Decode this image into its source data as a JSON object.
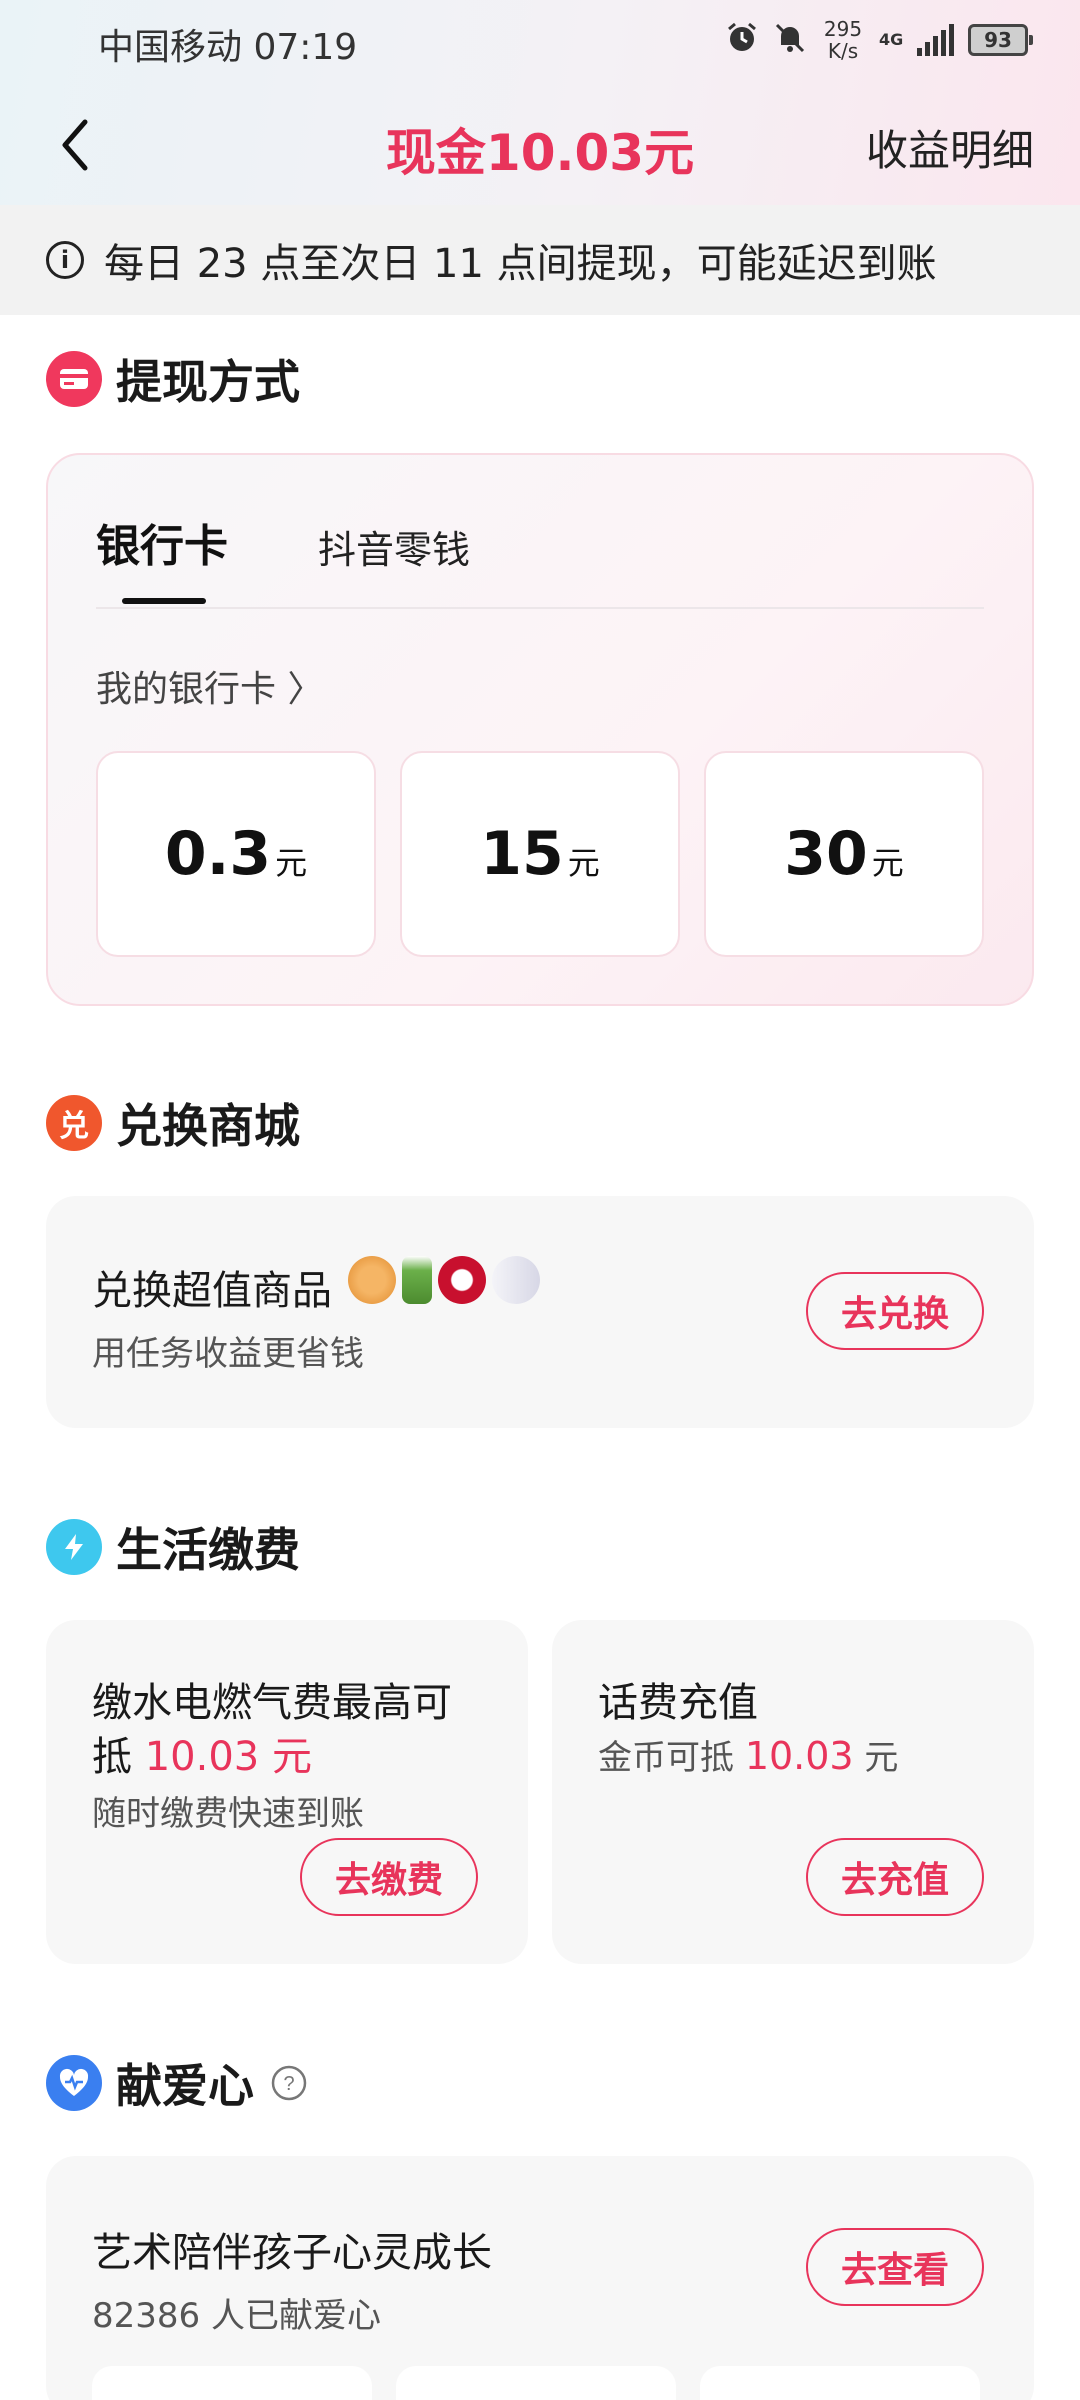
{
  "status_bar": {
    "carrier_time": "中国移动 07:19",
    "net_speed_value": "295",
    "net_speed_unit": "K/s",
    "network": "4G",
    "battery": "93"
  },
  "nav": {
    "title": "现金10.03元",
    "right_link": "收益明细"
  },
  "notice": {
    "text": "每日 23 点至次日 11 点间提现，可能延迟到账"
  },
  "withdraw": {
    "heading": "提现方式",
    "tabs": [
      {
        "label": "银行卡",
        "active": true
      },
      {
        "label": "抖音零钱",
        "active": false
      }
    ],
    "bank_link": "我的银行卡 〉",
    "amounts": [
      {
        "value": "0.3",
        "unit": "元"
      },
      {
        "value": "15",
        "unit": "元"
      },
      {
        "value": "30",
        "unit": "元"
      }
    ]
  },
  "exchange": {
    "heading": "兑换商城",
    "icon_char": "兑",
    "title": "兑换超值商品",
    "subtitle": "用任务收益更省钱",
    "button": "去兑换"
  },
  "life": {
    "heading": "生活缴费",
    "utility": {
      "title_line1": "缴水电燃气费最高可",
      "title_line2_prefix": "抵 ",
      "title_line2_amount": "10.03 元",
      "subtitle": "随时缴费快速到账",
      "button": "去缴费"
    },
    "phone": {
      "title": "话费充值",
      "subtitle_prefix": "金币可抵 ",
      "subtitle_amount": "10.03",
      "subtitle_suffix": " 元",
      "button": "去充值"
    }
  },
  "charity": {
    "heading": "献爱心",
    "title": "艺术陪伴孩子心灵成长",
    "subtitle": "82386 人已献爱心",
    "button": "去查看"
  },
  "colors": {
    "accent": "#e8345b",
    "exchange_icon": "#f0572d",
    "life_icon": "#3ec8ee",
    "charity_icon": "#3a7ff0"
  }
}
